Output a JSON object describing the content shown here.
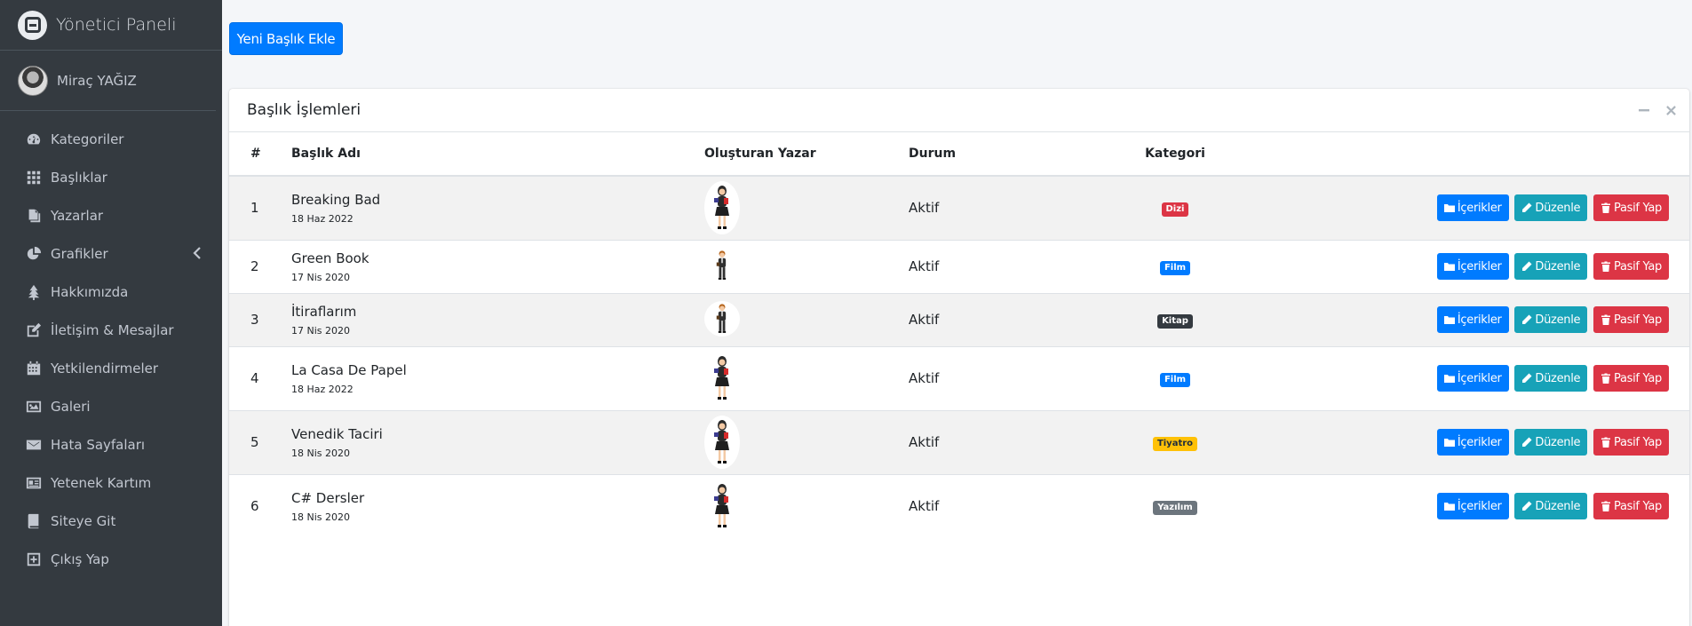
{
  "brand": {
    "title": "Yönetici Paneli"
  },
  "user": {
    "name": "Miraç YAĞIZ"
  },
  "sidebar": {
    "items": [
      {
        "label": "Kategoriler",
        "icon": "dashboard-icon"
      },
      {
        "label": "Başlıklar",
        "icon": "grid-icon"
      },
      {
        "label": "Yazarlar",
        "icon": "copy-icon"
      },
      {
        "label": "Grafikler",
        "icon": "pie-chart-icon",
        "has_chevron": true
      },
      {
        "label": "Hakkımızda",
        "icon": "tree-icon"
      },
      {
        "label": "İletişim & Mesajlar",
        "icon": "edit-icon"
      },
      {
        "label": "Yetkilendirmeler",
        "icon": "calendar-icon"
      },
      {
        "label": "Galeri",
        "icon": "image-icon"
      },
      {
        "label": "Hata Sayfaları",
        "icon": "envelope-icon"
      },
      {
        "label": "Yetenek Kartım",
        "icon": "id-card-icon"
      },
      {
        "label": "Siteye Git",
        "icon": "book-icon"
      },
      {
        "label": "Çıkış Yap",
        "icon": "plus-square-icon"
      }
    ]
  },
  "toolbar": {
    "add_label": "Yeni Başlık Ekle"
  },
  "card": {
    "title": "Başlık İşlemleri"
  },
  "table": {
    "headers": [
      "#",
      "Başlık Adı",
      "Oluşturan Yazar",
      "Durum",
      "Kategori",
      ""
    ],
    "rows": [
      {
        "num": "1",
        "name": "Breaking Bad",
        "date": "18 Haz 2022",
        "author": "female",
        "status": "Aktif",
        "category": "Dizi",
        "category_color": "#dc3545"
      },
      {
        "num": "2",
        "name": "Green Book",
        "date": "17 Nis 2020",
        "author": "male",
        "status": "Aktif",
        "category": "Film",
        "category_color": "#007bff"
      },
      {
        "num": "3",
        "name": "İtiraflarım",
        "date": "17 Nis 2020",
        "author": "male",
        "status": "Aktif",
        "category": "Kitap",
        "category_color": "#343a40"
      },
      {
        "num": "4",
        "name": "La Casa De Papel",
        "date": "18 Haz 2022",
        "author": "female",
        "status": "Aktif",
        "category": "Film",
        "category_color": "#007bff"
      },
      {
        "num": "5",
        "name": "Venedik Taciri",
        "date": "18 Nis 2020",
        "author": "female",
        "status": "Aktif",
        "category": "Tiyatro",
        "category_color": "#ffc107"
      },
      {
        "num": "6",
        "name": "C# Dersler",
        "date": "18 Nis 2020",
        "author": "female",
        "status": "Aktif",
        "category": "Yazılım",
        "category_color": "#6c757d"
      }
    ],
    "actions": {
      "contents": "İçerikler",
      "edit": "Düzenle",
      "deactivate": "Pasif Yap"
    }
  },
  "colors": {
    "sidebar_bg": "#343a40",
    "primary": "#007bff",
    "info": "#17a2b8",
    "danger": "#dc3545"
  }
}
